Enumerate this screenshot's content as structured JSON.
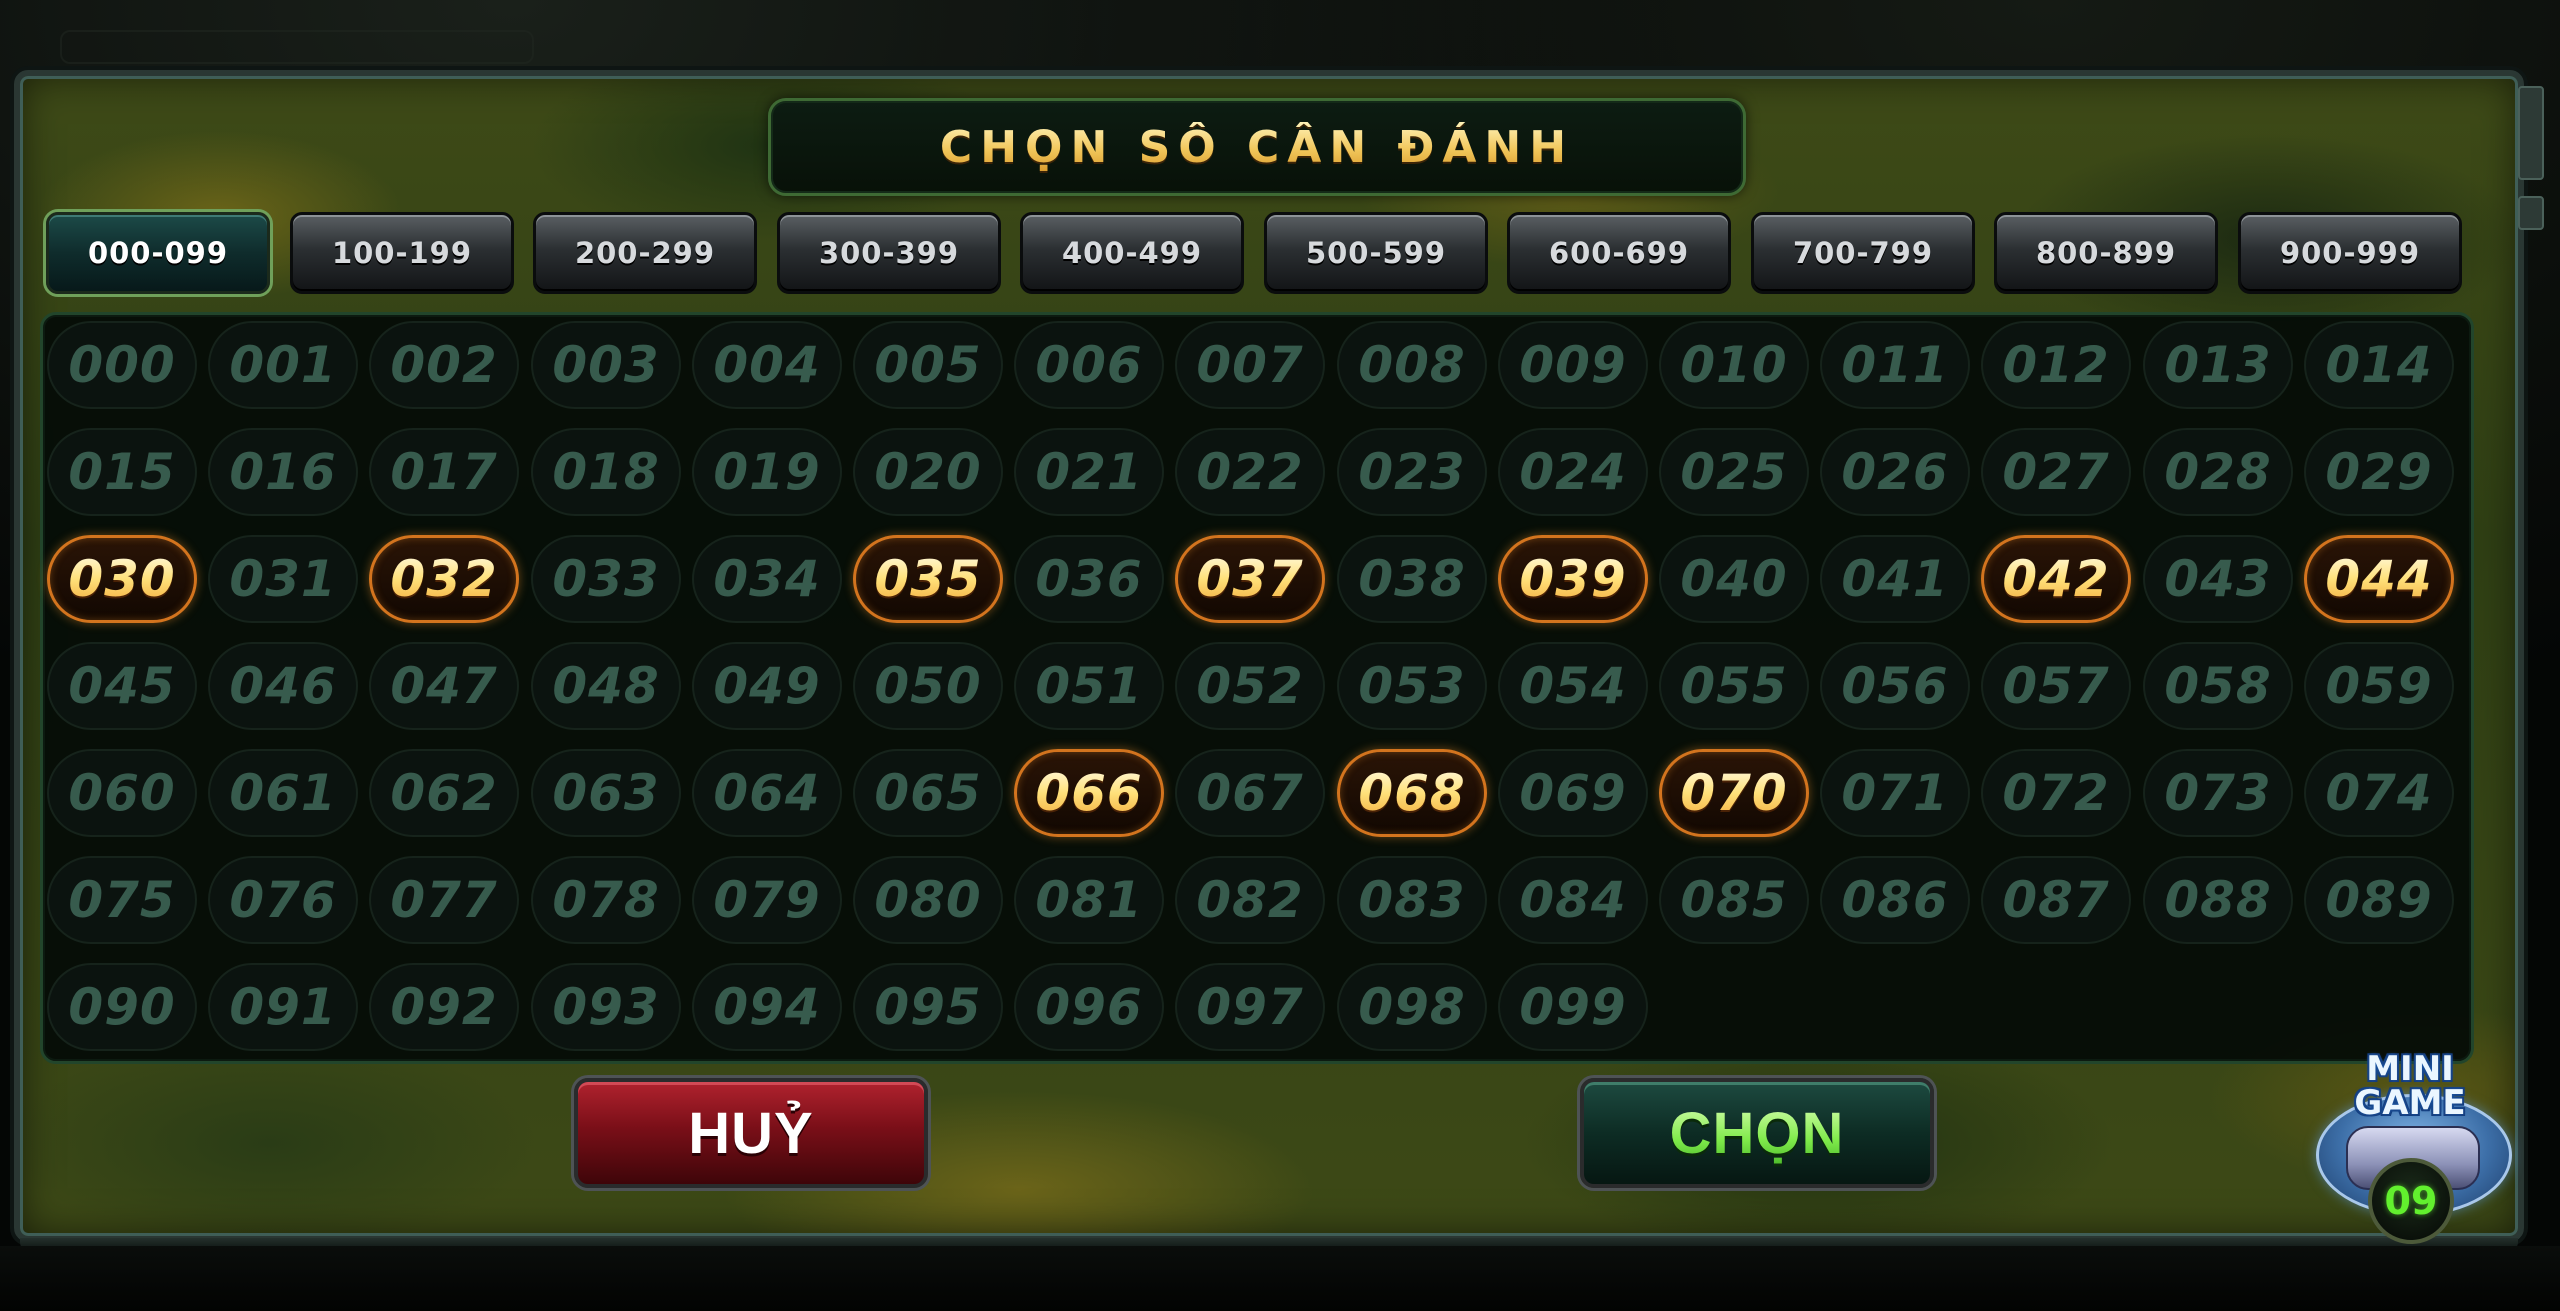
{
  "title": "CHỌN SỐ CẦN ĐÁNH",
  "tabs": [
    {
      "label": "000-099",
      "active": true
    },
    {
      "label": "100-199",
      "active": false
    },
    {
      "label": "200-299",
      "active": false
    },
    {
      "label": "300-399",
      "active": false
    },
    {
      "label": "400-499",
      "active": false
    },
    {
      "label": "500-599",
      "active": false
    },
    {
      "label": "600-699",
      "active": false
    },
    {
      "label": "700-799",
      "active": false
    },
    {
      "label": "800-899",
      "active": false
    },
    {
      "label": "900-999",
      "active": false
    }
  ],
  "numbers": [
    "000",
    "001",
    "002",
    "003",
    "004",
    "005",
    "006",
    "007",
    "008",
    "009",
    "010",
    "011",
    "012",
    "013",
    "014",
    "015",
    "016",
    "017",
    "018",
    "019",
    "020",
    "021",
    "022",
    "023",
    "024",
    "025",
    "026",
    "027",
    "028",
    "029",
    "030",
    "031",
    "032",
    "033",
    "034",
    "035",
    "036",
    "037",
    "038",
    "039",
    "040",
    "041",
    "042",
    "043",
    "044",
    "045",
    "046",
    "047",
    "048",
    "049",
    "050",
    "051",
    "052",
    "053",
    "054",
    "055",
    "056",
    "057",
    "058",
    "059",
    "060",
    "061",
    "062",
    "063",
    "064",
    "065",
    "066",
    "067",
    "068",
    "069",
    "070",
    "071",
    "072",
    "073",
    "074",
    "075",
    "076",
    "077",
    "078",
    "079",
    "080",
    "081",
    "082",
    "083",
    "084",
    "085",
    "086",
    "087",
    "088",
    "089",
    "090",
    "091",
    "092",
    "093",
    "094",
    "095",
    "096",
    "097",
    "098",
    "099"
  ],
  "selected_numbers": [
    "030",
    "032",
    "035",
    "037",
    "039",
    "042",
    "044",
    "066",
    "068",
    "070"
  ],
  "buttons": {
    "cancel_label": "HUỶ",
    "choose_label": "CHỌN"
  },
  "minigame": {
    "label_line1": "MINI",
    "label_line2": "GAME",
    "counter": "09"
  },
  "colors": {
    "selected_border": "#d3741e",
    "selected_text": "#ffe17a",
    "number_text": "#375b4d",
    "title_text": "#f1c65a",
    "cancel_button": "#7a0f18",
    "choose_button": "#0d2c24",
    "choose_text": "#7fea4a",
    "counter_text": "#62f02e"
  }
}
